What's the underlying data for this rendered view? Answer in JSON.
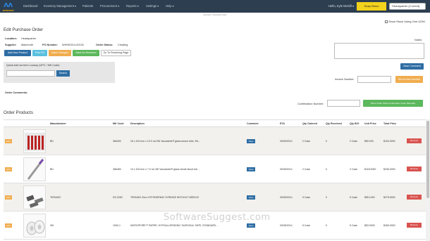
{
  "nav": {
    "logo_text": "artsmed",
    "items": [
      "Dashboard",
      "Inventory Management ▾",
      "Patients",
      "Procurement ▾",
      "Reports ▾",
      "Settings ▾",
      "Help ▾"
    ],
    "hello": "Hello, Kyle McGill ▾",
    "snap_button": "Snap Demo",
    "location_select": "Headquarter (Current)"
  },
  "crumb": "Inventory / Purchase Order",
  "show_stock": "Show Stock Using One UOM",
  "page_title": "Edit Purchase Order",
  "location": {
    "label": "Location:",
    "value": "Headquarter"
  },
  "supplier": {
    "label": "Supplier:",
    "value": "Mammoth"
  },
  "po_number": {
    "label": "PO Number:",
    "value": "WH090214-00192"
  },
  "order_status": {
    "label": "Order Status:",
    "value": "Creating"
  },
  "actions": {
    "add_product": "Add New Product",
    "print": "Print PO",
    "make_changes": "Make Changes",
    "mark_received": "Mark As Received",
    "go_receiving": "Go To Receiving Page"
  },
  "quick_add": {
    "label": "Quick Add via Item Lookup (UPC / Mfr Code)",
    "search_button": "Search"
  },
  "notes_label": "Notes:",
  "save_comment": "Save Comment",
  "invoice": {
    "label": "Invoice Number:",
    "set_button": "Set Invoice Number"
  },
  "order_comments_label": "Order Comments:",
  "confirmation": {
    "label": "Confirmation Number:",
    "button": "Place Order With Confirmation Code Manually"
  },
  "section_title": "Order Products",
  "table": {
    "headers": [
      "",
      "",
      "Manufacturer",
      "Mfr Code",
      "Description",
      "Comment",
      "ETA",
      "Qty Ordered",
      "Qty Received",
      "Qty B/O",
      "Unit Price",
      "Total Price",
      ""
    ],
    "edit_label": "Edit",
    "save_label": "Save",
    "remove_label": "Remove",
    "rows": [
      {
        "manufacturer": "BD",
        "code": "366430",
        "description": "16 x 100 mm x 10.0 mL BD Vacutainer® glass serum tube, Re...",
        "eta": "09/05/2014",
        "qty_ordered": "2 Case",
        "qty_received": "0",
        "qty_bo": "2 Case",
        "unit_price": "$50.000",
        "total_price": "$100.0000"
      },
      {
        "manufacturer": "BD",
        "code": "366450",
        "description": "13 x 100 mm x 7.0 mL BD Vacutainer® glass whole blood tub...",
        "eta": "09/05/2014",
        "qty_ordered": "2 Case",
        "qty_received": "0",
        "qty_bo": "2 Case",
        "unit_price": "$118.0000",
        "total_price": "$236.0000"
      },
      {
        "manufacturer": "TERUMO",
        "code": "SS-20S2",
        "description": "TERUMO 20cc HYPODERMIC SYRINGE WITHOUT NEEDLE",
        "eta": "09/05/2014",
        "qty_ordered": "5 Case",
        "qty_received": "0",
        "qty_bo": "5 Case",
        "unit_price": "$55.1000",
        "total_price": "$275.5000"
      },
      {
        "manufacturer": "3M",
        "code": "1530-1",
        "description": "MICROPORE™ PAPER, HYPOALLERGENIC SURGICAL TAPE, STANDARD ...",
        "eta": "09/05/2014",
        "qty_ordered": "5 Case",
        "qty_received": "0",
        "qty_bo": "5 Case",
        "unit_price": "$53.0000",
        "total_price": "$265.0000"
      }
    ]
  },
  "watermark": "SoftwareSuggest.com"
}
